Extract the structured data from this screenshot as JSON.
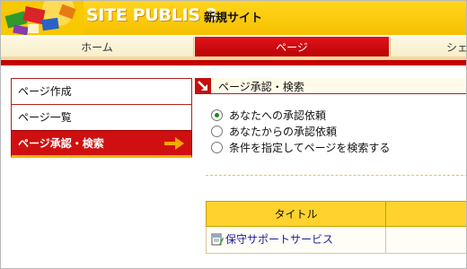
{
  "header": {
    "brand": "SITE PUBLIS 3",
    "site_name": "新規サイト"
  },
  "nav": {
    "tabs": [
      {
        "label": "ホーム"
      },
      {
        "label": "ページ"
      },
      {
        "label": "シェ"
      }
    ],
    "active_tab": 1
  },
  "sidebar": {
    "items": [
      {
        "label": "ページ作成"
      },
      {
        "label": "ページ一覧"
      },
      {
        "label": "ページ承認・検索"
      }
    ],
    "active_item": 2
  },
  "content": {
    "title": "ページ承認・検索",
    "radio_options": [
      {
        "label": "あなたへの承認依頼"
      },
      {
        "label": "あなたからの承認依頼"
      },
      {
        "label": "条件を指定してページを検索する"
      }
    ],
    "selected_radio": 0,
    "table": {
      "headers": [
        "タイトル",
        ""
      ],
      "rows": [
        {
          "title": "保守サポートサービス",
          "col2": ""
        }
      ]
    }
  },
  "colors": {
    "header_yellow": "#f6c000",
    "nav_red": "#c40000",
    "table_header": "#ffd22e",
    "link_blue": "#1a1aa0"
  }
}
